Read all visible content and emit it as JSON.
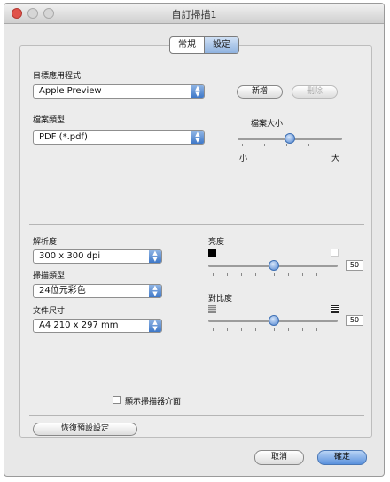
{
  "window": {
    "title": "自訂掃描1"
  },
  "tabs": [
    {
      "label": "常規"
    },
    {
      "label": "設定"
    }
  ],
  "app": {
    "label": "目標應用程式",
    "value": "Apple Preview",
    "new_label": "新增",
    "delete_label": "刪除"
  },
  "file_type": {
    "label": "檔案類型",
    "value": "PDF (*.pdf)"
  },
  "file_size": {
    "label": "檔案大小",
    "min_label": "小",
    "max_label": "大",
    "level": 0.5
  },
  "resolution": {
    "label": "解析度",
    "value": "300 x 300 dpi"
  },
  "scan_type": {
    "label": "掃描類型",
    "value": "24位元彩色"
  },
  "doc_size": {
    "label": "文件尺寸",
    "value": "A4 210 x 297 mm"
  },
  "brightness": {
    "label": "亮度",
    "value": "50"
  },
  "contrast": {
    "label": "對比度",
    "value": "50"
  },
  "show_interface": {
    "label": "顯示掃描器介面",
    "checked": false
  },
  "restore_label": "恢復預設設定",
  "footer": {
    "cancel_label": "取消",
    "ok_label": "確定"
  }
}
